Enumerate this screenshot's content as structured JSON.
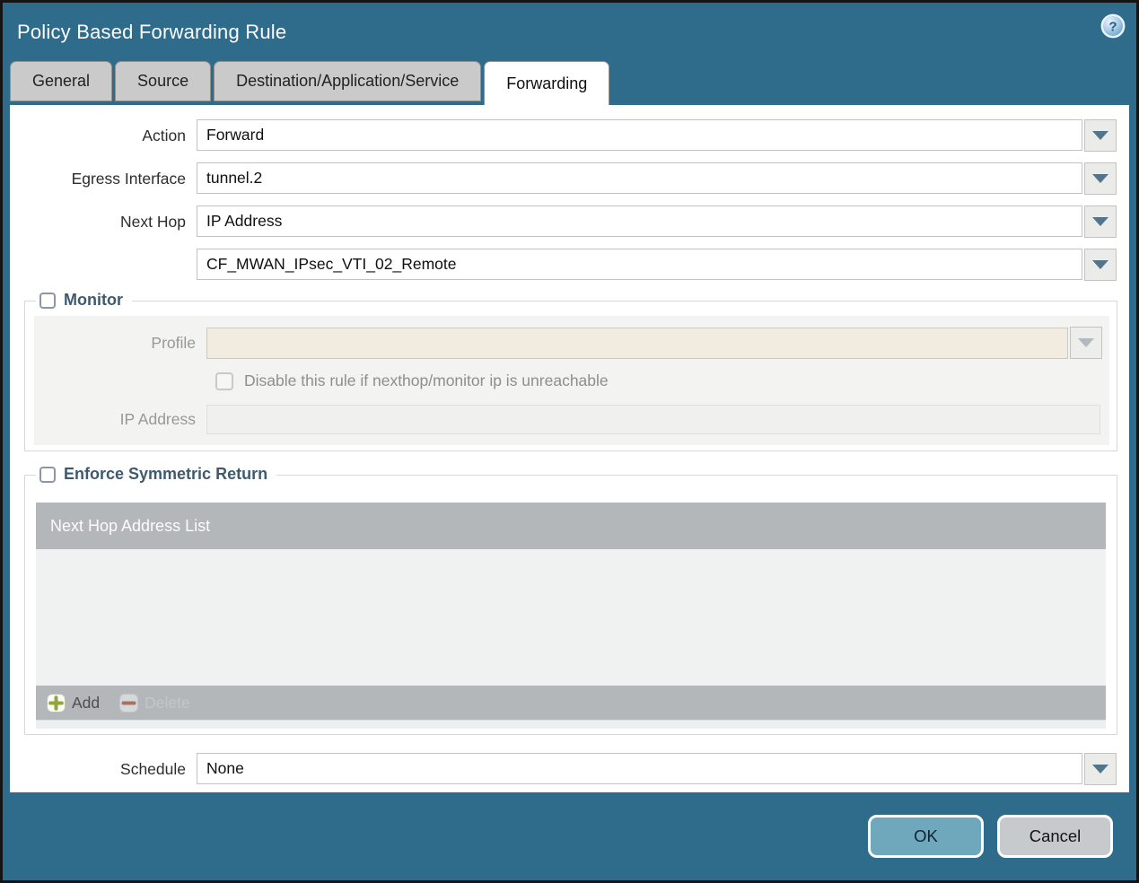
{
  "dialog": {
    "title": "Policy Based Forwarding Rule"
  },
  "icons": {
    "help": "?",
    "dropdown": "chevron-down",
    "add": "plus",
    "delete": "minus"
  },
  "tabs": [
    {
      "label": "General",
      "active": false
    },
    {
      "label": "Source",
      "active": false
    },
    {
      "label": "Destination/Application/Service",
      "active": false
    },
    {
      "label": "Forwarding",
      "active": true
    }
  ],
  "form": {
    "action": {
      "label": "Action",
      "value": "Forward"
    },
    "egress_interface": {
      "label": "Egress Interface",
      "value": "tunnel.2"
    },
    "next_hop": {
      "label": "Next Hop",
      "value": "IP Address"
    },
    "next_hop_address": {
      "value": "CF_MWAN_IPsec_VTI_02_Remote"
    },
    "schedule": {
      "label": "Schedule",
      "value": "None"
    }
  },
  "monitor": {
    "label": "Monitor",
    "checked": false,
    "enabled": false,
    "profile": {
      "label": "Profile",
      "value": ""
    },
    "disable_rule": {
      "label": "Disable this rule if nexthop/monitor ip is unreachable",
      "checked": false
    },
    "ip_address": {
      "label": "IP Address",
      "value": ""
    }
  },
  "enforce_symmetric_return": {
    "label": "Enforce Symmetric Return",
    "checked": false,
    "table": {
      "header": "Next Hop Address List",
      "rows": []
    },
    "toolbar": {
      "add_label": "Add",
      "delete_label": "Delete",
      "delete_enabled": false
    }
  },
  "footer": {
    "ok_label": "OK",
    "cancel_label": "Cancel"
  },
  "colors": {
    "titlebar_bg": "#2f6b8b",
    "active_tab_bg": "#ffffff",
    "inactive_tab_bg": "#cacaca",
    "disabled_profile_bg": "#f1ecdf",
    "table_header_bg": "#b3b7ba",
    "ok_button_bg": "#6fa8bc",
    "cancel_button_bg": "#c6cacd",
    "add_icon_green": "#92a43c",
    "delete_icon_red": "#a57264",
    "section_label_color": "#3d5a6e"
  }
}
